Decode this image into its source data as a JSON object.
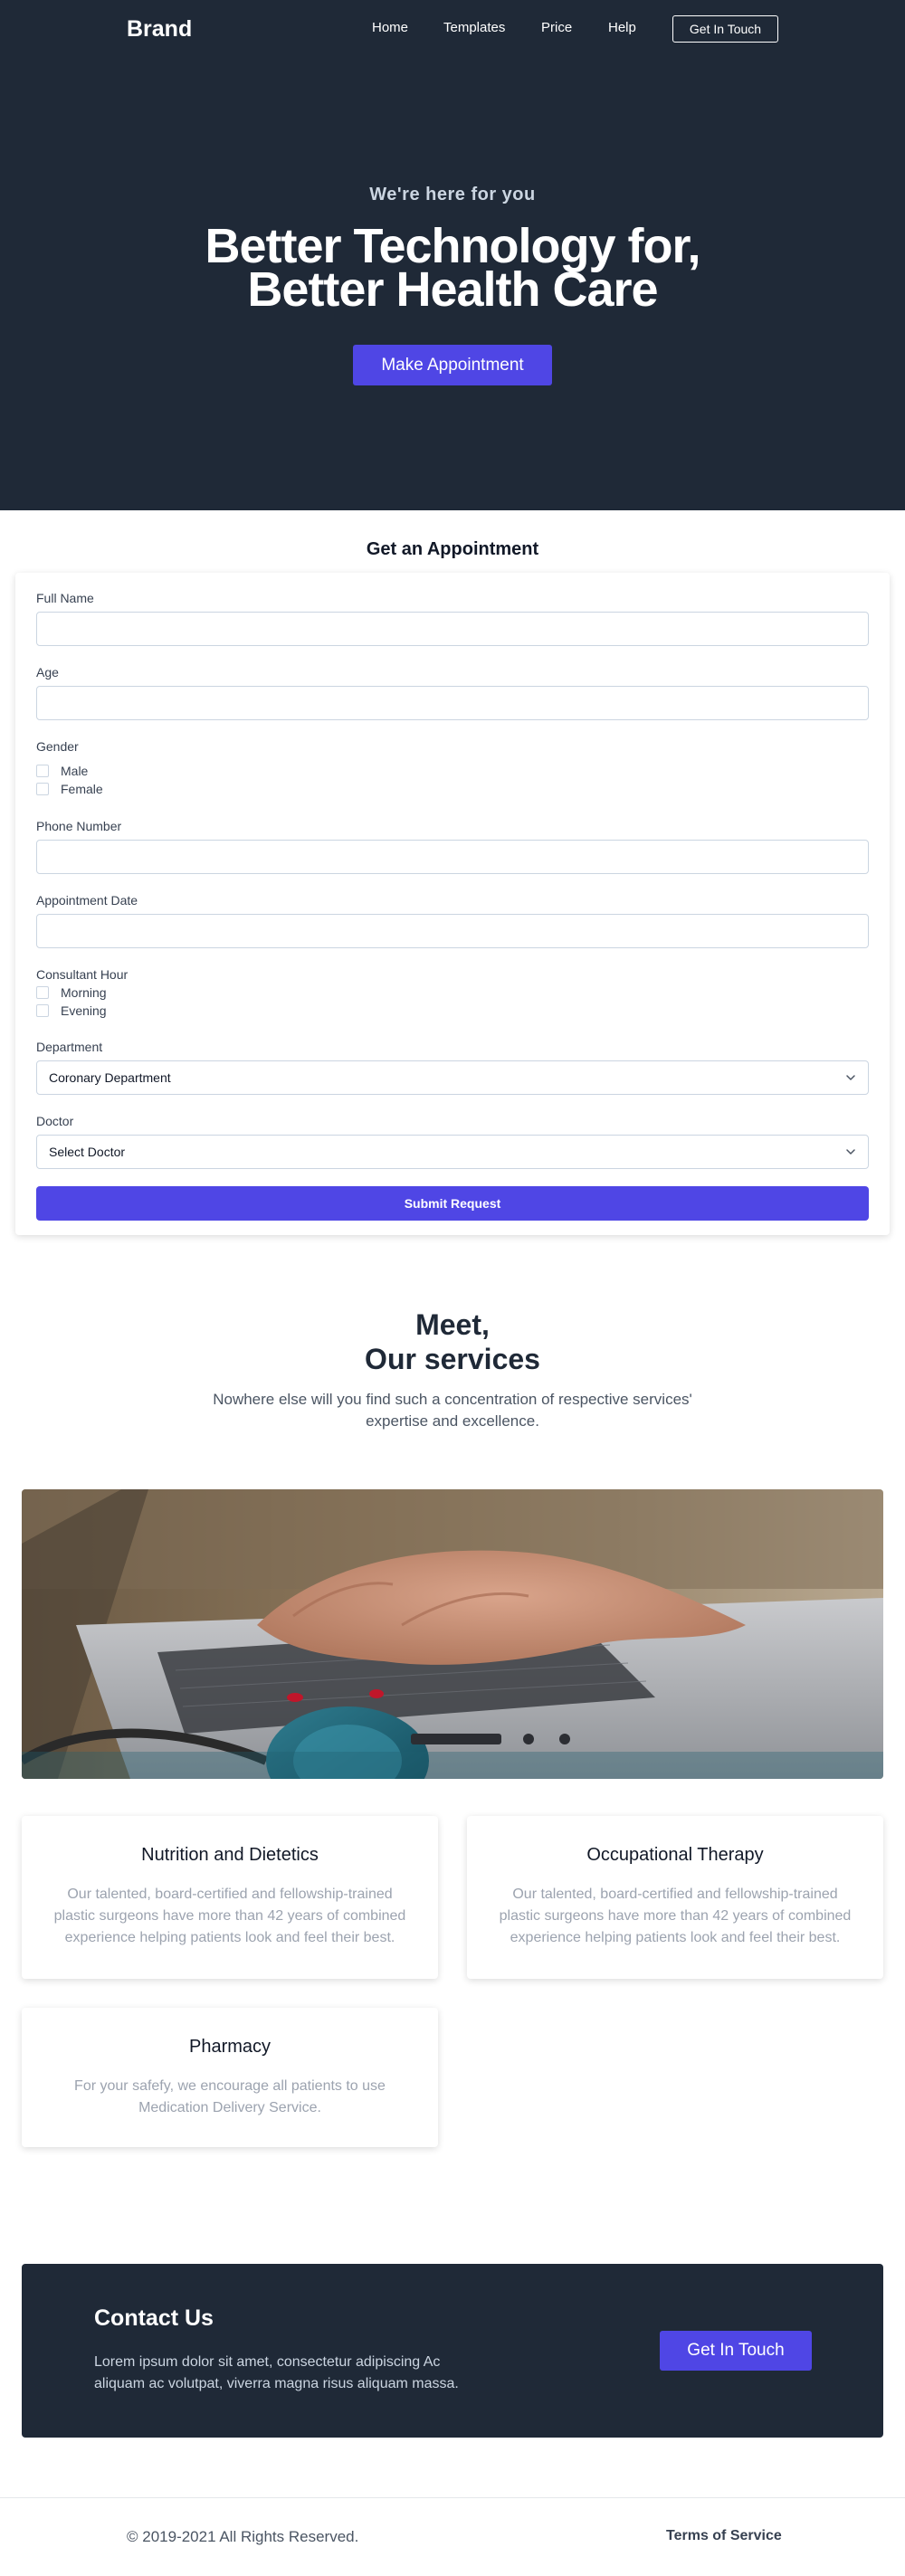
{
  "nav": {
    "brand": "Brand",
    "links": [
      "Home",
      "Templates",
      "Price",
      "Help"
    ],
    "cta": "Get In Touch"
  },
  "hero": {
    "kicker": "We're here for you",
    "title_line1": "Better Technology for,",
    "title_line2": "Better Health Care",
    "button": "Make Appointment"
  },
  "form": {
    "heading": "Get an Appointment",
    "full_name_label": "Full Name",
    "full_name_value": "",
    "age_label": "Age",
    "age_value": "",
    "gender_label": "Gender",
    "gender_options": [
      "Male",
      "Female"
    ],
    "phone_label": "Phone Number",
    "phone_value": "",
    "date_label": "Appointment Date",
    "date_value": "",
    "hour_label": "Consultant Hour",
    "hour_options": [
      "Morning",
      "Evening"
    ],
    "department_label": "Department",
    "department_value": "Coronary Department",
    "doctor_label": "Doctor",
    "doctor_value": "Select Doctor",
    "submit": "Submit Request"
  },
  "services": {
    "title_line1": "Meet,",
    "title_line2": "Our services",
    "subtitle": "Nowhere else will you find such a concentration of respective services' expertise and excellence.",
    "cards": [
      {
        "title": "Nutrition and Dietetics",
        "text": "Our talented, board-certified and fellowship-trained plastic surgeons have more than 42 years of combined experience helping patients look and feel their best."
      },
      {
        "title": "Occupational Therapy",
        "text": "Our talented, board-certified and fellowship-trained plastic surgeons have more than 42 years of combined experience helping patients look and feel their best."
      },
      {
        "title": "Pharmacy",
        "text": "For your safefy, we encourage all patients to use Medication Delivery Service."
      }
    ]
  },
  "contact": {
    "title": "Contact Us",
    "text": "Lorem ipsum dolor sit amet, consectetur adipiscing Ac aliquam ac volutpat, viverra magna risus aliquam massa.",
    "button": "Get In Touch"
  },
  "footer": {
    "copyright": "© 2019-2021 All Rights Reserved.",
    "terms": "Terms of Service"
  },
  "colors": {
    "dark": "#1f2937",
    "accent": "#4f46e5",
    "muted": "#9ca3af"
  },
  "icons": [
    "chevron-down-icon"
  ]
}
